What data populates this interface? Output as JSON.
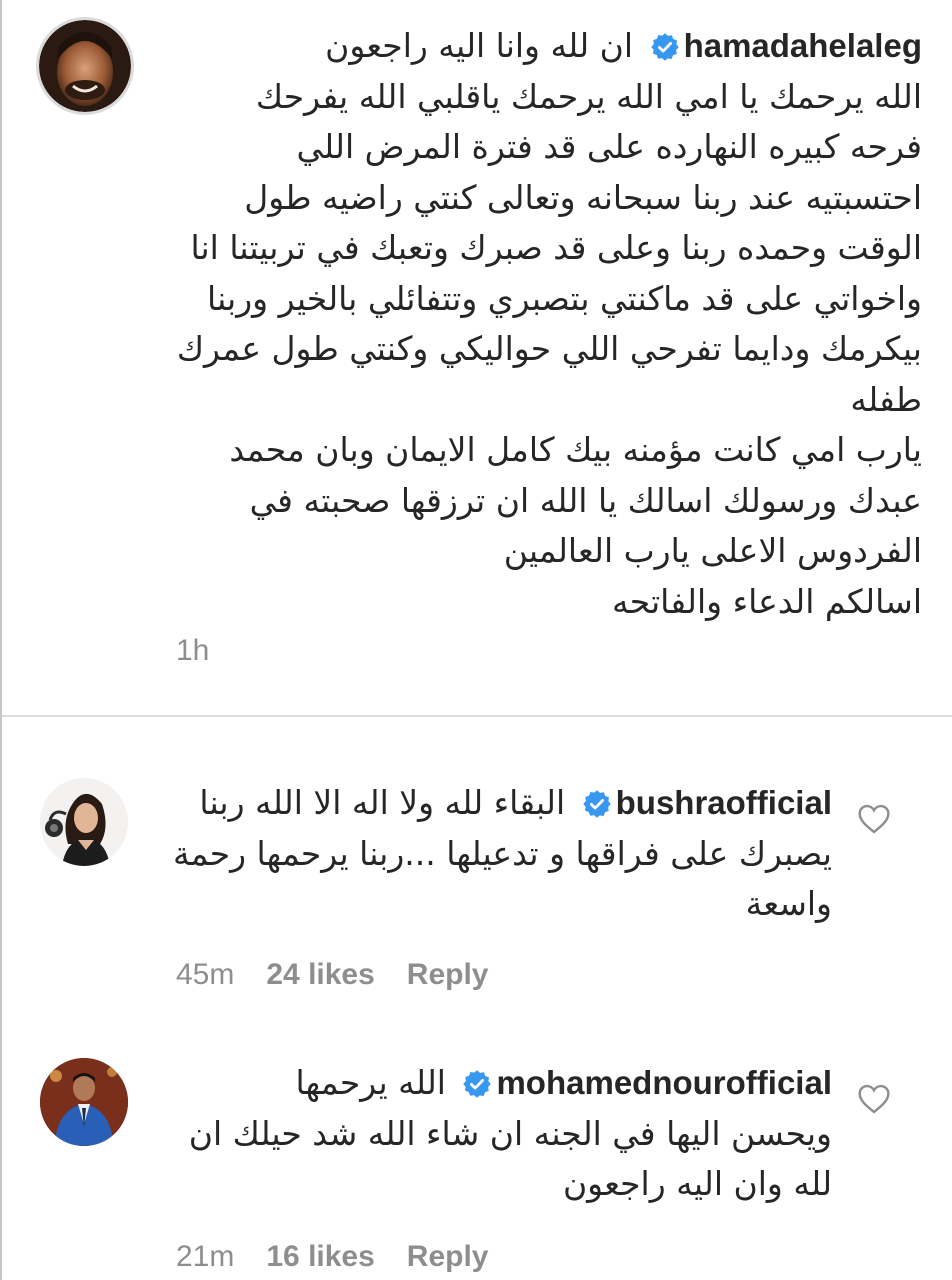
{
  "comments": [
    {
      "username": "hamadahelaleg",
      "verified": true,
      "text_lines": [
        "ان لله وانا اليه راجعون",
        "الله يرحمك يا امي الله يرحمك ياقلبي الله يفرحك",
        "فرحه كبيره النهارده على قد فترة المرض اللي",
        "احتسبتيه عند ربنا سبحانه وتعالى كنتي راضيه طول",
        "الوقت وحمده ربنا وعلى قد صبرك وتعبك في تربيتنا انا",
        "واخواتي على قد ماكنتي بتصبري وتتفائلي بالخير وربنا",
        "بيكرمك ودايما تفرحي اللي حواليكي وكنتي طول عمرك",
        "طفله",
        "يارب امي كانت مؤمنه بيك كامل الايمان وبان محمد",
        "عبدك ورسولك اسالك يا الله ان ترزقها صحبته في",
        "الفردوس الاعلى يارب العالمين",
        "اسالكم الدعاء والفاتحه"
      ],
      "time": "1h"
    },
    {
      "username": "bushraofficial",
      "verified": true,
      "text_lines": [
        "البقاء لله ولا اله الا الله ربنا",
        "يصبرك على فراقها و تدعيلها ...ربنا يرحمها رحمة",
        "واسعة"
      ],
      "time": "45m",
      "likes": "24 likes",
      "reply": "Reply"
    },
    {
      "username": "mohamednourofficial",
      "verified": true,
      "text_lines": [
        "الله يرحمها",
        "ويحسن اليها في الجنه ان شاء الله شد حيلك ان",
        "لله وان اليه راجعون"
      ],
      "time": "21m",
      "likes": "16 likes",
      "reply": "Reply"
    }
  ],
  "icons": {
    "verified": "verified-badge-icon",
    "like": "heart-outline-icon"
  },
  "colors": {
    "text": "#262626",
    "meta": "#8e8e8e",
    "verified_blue": "#3897f0",
    "divider": "#dbdbdb"
  }
}
